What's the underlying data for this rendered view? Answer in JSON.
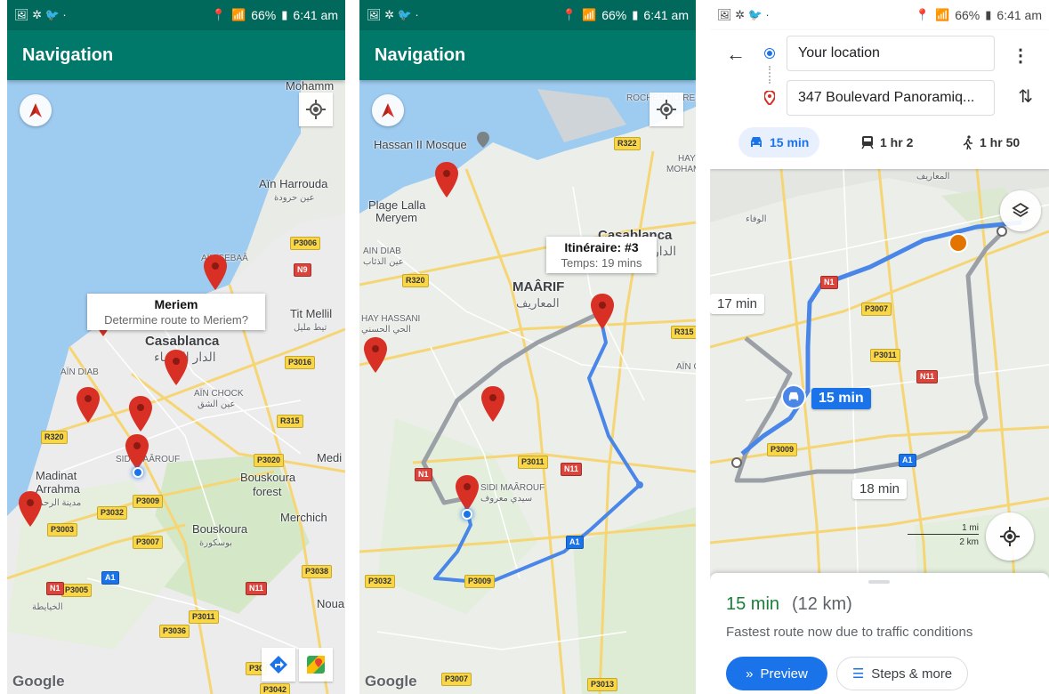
{
  "status_bar": {
    "left_icons": "🖼 ✲ 🐦 ·",
    "battery": "66%",
    "time": "6:41 am"
  },
  "phone1": {
    "title": "Navigation",
    "labels": {
      "ain_harrouda": "Aïn Harrouda",
      "ain_harrouda_ar": "عين حرودة",
      "tit_mellil": "Tit Mellil",
      "tit_mellil_ar": "تيط مليل",
      "casablanca": "Casablanca",
      "casablanca_ar": "الدار البيضاء",
      "ain_diab": "AÏN DIAB",
      "ain_chock": "AÏN CHOCK",
      "ain_chock_ar": "عين الشق",
      "sidi_maarouf": "SIDI MAÂROUF",
      "madinat": "Madinat",
      "arrahma": "Arrahma",
      "arrahma_ar": "مدينة الرحمة",
      "bouskoura_forest": "Bouskoura",
      "forest": "forest",
      "merchich": "Merchich",
      "bouskoura": "Bouskoura",
      "bouskoura_ar": "بوسكورة",
      "mohammedia": "Mohamm",
      "mediouna": "Medi",
      "noua": "Noua",
      "khaybita_ar": "الخيايطة",
      "ain_sebaa": "AÏN SEBAÂ"
    },
    "shields": [
      "P3006",
      "N9",
      "P3016",
      "R315",
      "P3020",
      "R320",
      "P3009",
      "P3032",
      "P3003",
      "P3007",
      "P3038",
      "P3005",
      "P3011",
      "P3036",
      "N11",
      "A1",
      "N1",
      "P3042",
      "P30"
    ],
    "popup": {
      "title": "Meriem",
      "subtitle": "Determine route to Meriem?"
    }
  },
  "phone2": {
    "title": "Navigation",
    "labels": {
      "hassan": "Hassan II Mosque",
      "plage": "Plage Lalla",
      "meryem": "Meryem",
      "ain_diab": "AIN DIAB",
      "ain_diab_ar": "عين الذئاب",
      "casablanca": "Casablanca",
      "casablanca_ar": "الدار",
      "maarif": "MAÂRIF",
      "maarif_ar": "المعاريف",
      "hay_hassani": "HAY HASSANI",
      "hay_hassani_ar": "الحي الحسني",
      "sidi_maarouf": "SIDI MAÂROUF",
      "sidi_maarouf_ar": "سيدي معروف",
      "ain_chock": "AÏN CH",
      "roches_noires": "ROCHES NOIRES",
      "mohammed": "MOHAM",
      "hay": "HAY"
    },
    "shields": [
      "R322",
      "R320",
      "R315",
      "P3011",
      "N11",
      "N1",
      "A1",
      "P3032",
      "P3009",
      "P3007",
      "P3013"
    ],
    "popup": {
      "title": "Itinéraire: #3",
      "subtitle": "Temps: 19 mins"
    }
  },
  "phone3": {
    "origin": "Your location",
    "destination": "347 Boulevard Panoramiq...",
    "modes": [
      {
        "icon": "car-icon",
        "label": "15 min",
        "active": true
      },
      {
        "icon": "transit-icon",
        "label": "1 hr 2",
        "active": false
      },
      {
        "icon": "walk-icon",
        "label": "1 hr 50",
        "active": false
      }
    ],
    "route_times": {
      "alt1": "17 min",
      "main": "15 min",
      "alt2": "18 min"
    },
    "map_labels": {
      "maarif_ar": "المعاريف",
      "wafa_ar": "الوفاء"
    },
    "shields": [
      "N1",
      "P3007",
      "P3011",
      "N11",
      "P3009",
      "A1"
    ],
    "scale": {
      "mi": "1 mi",
      "km": "2 km"
    },
    "sheet": {
      "time": "15 min",
      "distance": "(12 km)",
      "description": "Fastest route now due to traffic conditions",
      "preview": "Preview",
      "steps": "Steps & more"
    }
  },
  "colors": {
    "appbar": "#00796b",
    "statusbar": "#00695c",
    "route_blue": "#1a73e8",
    "pin_red": "#d93025"
  },
  "google_logo": "Google"
}
